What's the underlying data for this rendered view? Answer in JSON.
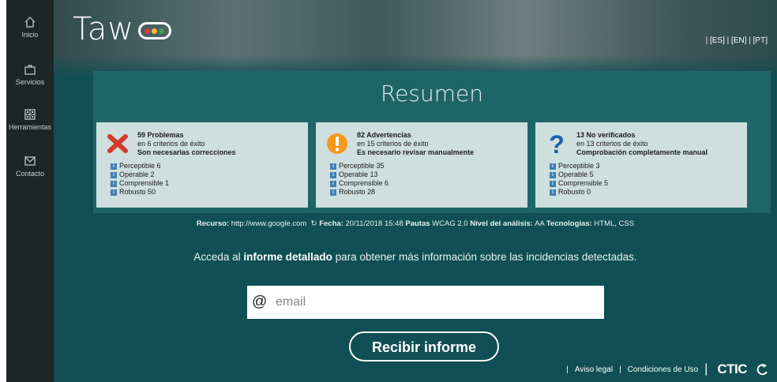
{
  "sidebar": {
    "items": [
      {
        "label": "Inicio",
        "icon": "home-icon"
      },
      {
        "label": "Servicios",
        "icon": "briefcase-icon"
      },
      {
        "label": "Herramientas",
        "icon": "grid-icon"
      },
      {
        "label": "Contacto",
        "icon": "envelope-icon"
      }
    ]
  },
  "header": {
    "logo_text": "Taw",
    "langs": [
      "[ES]",
      "[EN]",
      "[PT]"
    ],
    "logo_dot_colors": [
      "#e53935",
      "#fbc02d",
      "#43a047"
    ]
  },
  "summary": {
    "title": "Resumen",
    "cards": [
      {
        "icon": "error-x-icon",
        "line1": "59 Problemas",
        "line2": "en 6 criterios de éxito",
        "line3": "Son necesarias correcciones",
        "items": [
          "Perceptible 6",
          "Operable 2",
          "Comprensible 1",
          "Robusto 50"
        ]
      },
      {
        "icon": "warning-icon",
        "line1": "82 Advertencias",
        "line2": "en 15 criterios de éxito",
        "line3": "Es necesario revisar manualmente",
        "items": [
          "Perceptible 35",
          "Operable 13",
          "Comprensible 6",
          "Robusto 28"
        ]
      },
      {
        "icon": "question-icon",
        "line1": "13 No verificados",
        "line2": "en 13 criterios de éxito",
        "line3": "Comprobación completamente manual",
        "items": [
          "Perceptible 3",
          "Operable 5",
          "Comprensible 5",
          "Robusto 0"
        ]
      }
    ]
  },
  "meta": {
    "recurso_label": "Recurso:",
    "recurso_value": "http://www.google.com",
    "fecha_label": "Fecha:",
    "fecha_value": "20/11/2018 15:48",
    "pautas_label": "Pautas",
    "pautas_value": "WCAG 2.0",
    "nivel_label": "Nivel del análisis:",
    "nivel_value": "AA",
    "tec_label": "Tecnologías:",
    "tec_value": "HTML, CSS"
  },
  "info": {
    "before": "Acceda al ",
    "bold": "informe detallado",
    "after": " para obtener más información sobre las incidencias detectadas."
  },
  "email": {
    "at": "@",
    "placeholder": "email",
    "value": ""
  },
  "button": {
    "label": "Recibir informe"
  },
  "footer": {
    "sep": "|",
    "aviso": "Aviso legal",
    "condiciones": "Condiciones de Uso",
    "brand": "CTIC"
  },
  "colors": {
    "teal_bg": "#0f4f55",
    "sidebar_bg": "#1f2527",
    "card_bg": "#cfdfde",
    "error": "#d23a2a",
    "warning": "#f39a1e",
    "question": "#1f5fb0"
  }
}
